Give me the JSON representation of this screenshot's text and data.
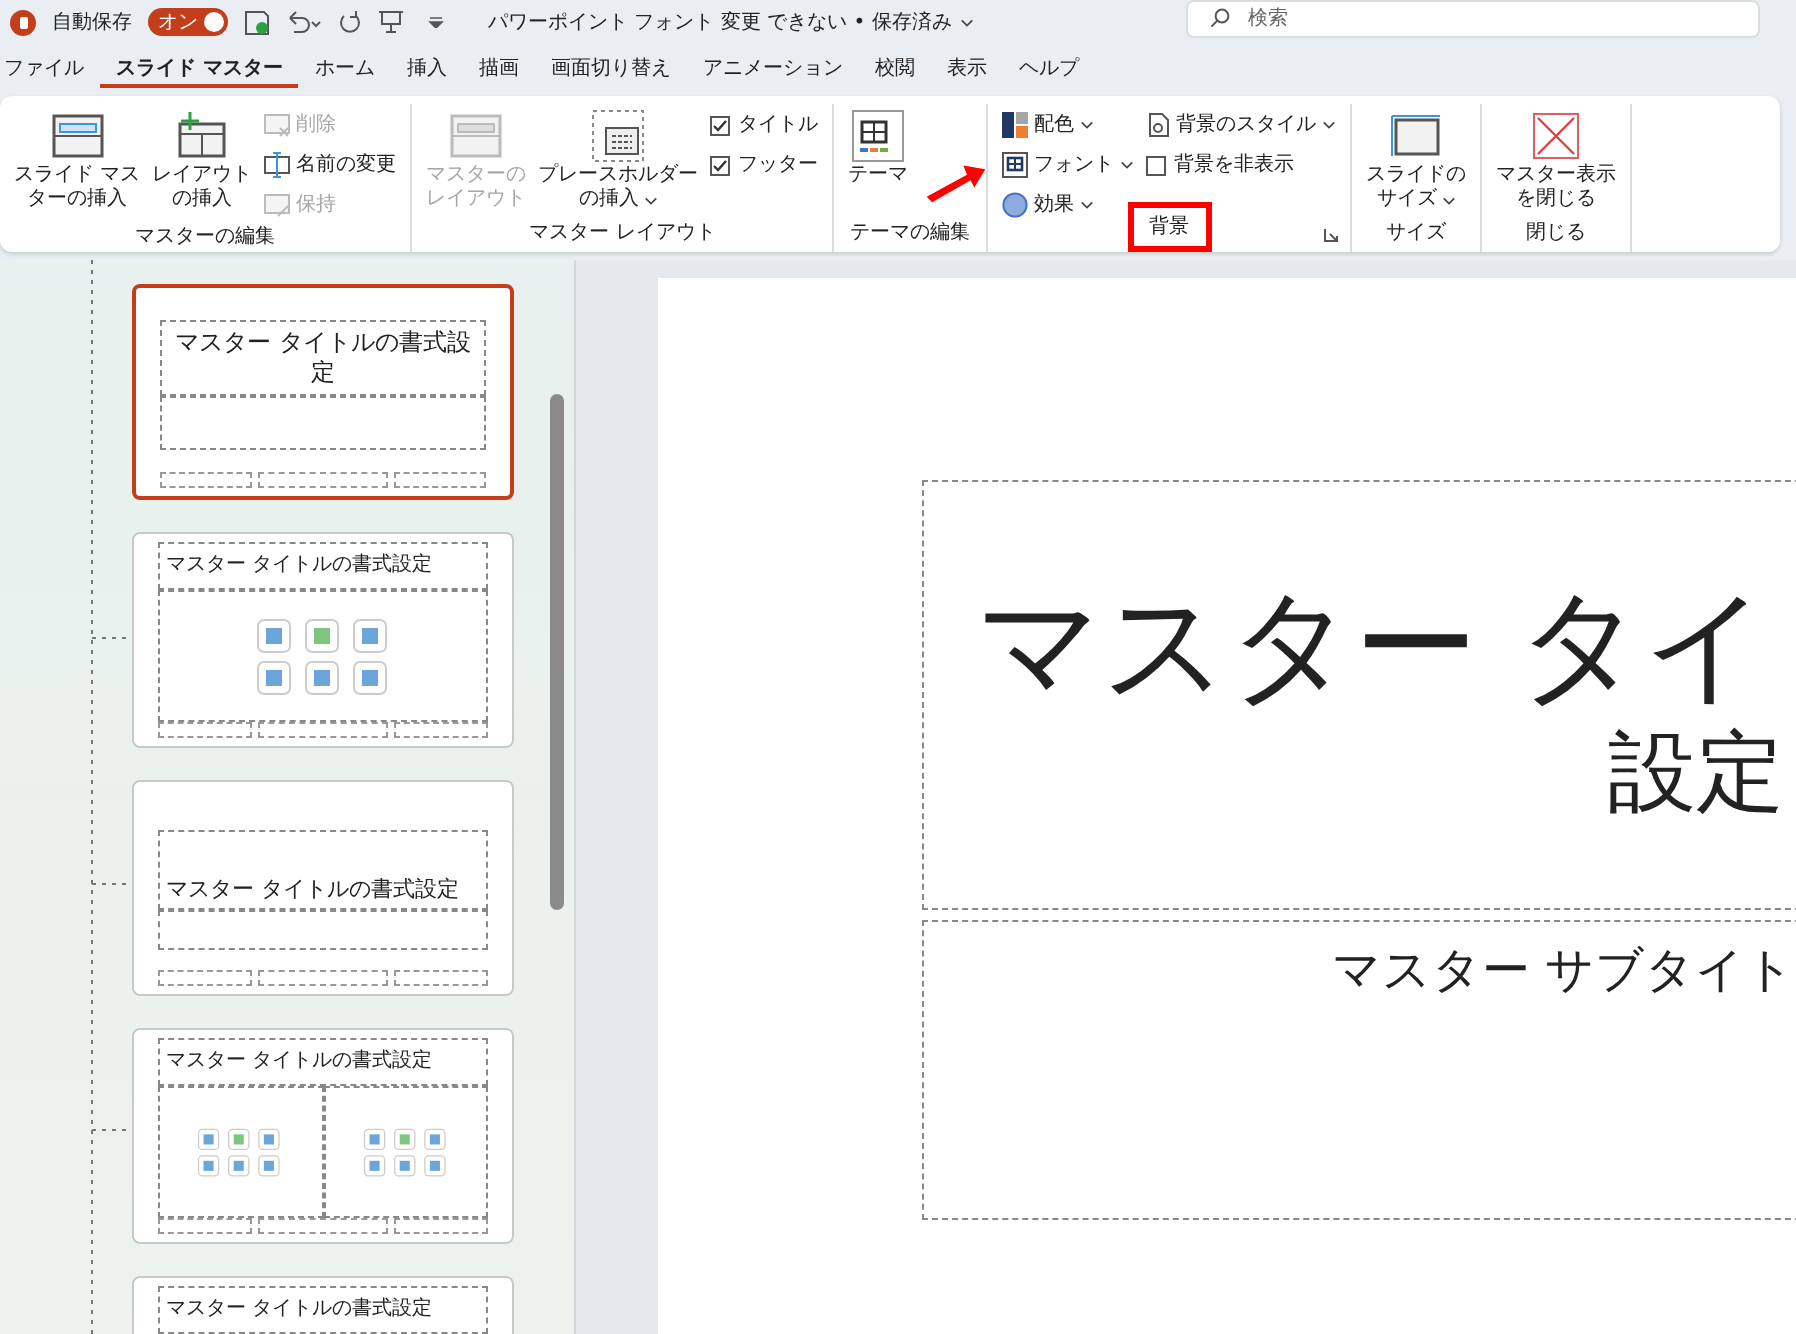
{
  "titlebar": {
    "autosave_label": "自動保存",
    "autosave_toggle": {
      "label": "オン",
      "on": true
    },
    "document_title": "パワーポイント フォント 変更 できない • 保存済み",
    "search": {
      "placeholder": "検索"
    }
  },
  "tabs": [
    {
      "label": "ファイル",
      "selected": false
    },
    {
      "label": "スライド マスター",
      "selected": true
    },
    {
      "label": "ホーム",
      "selected": false
    },
    {
      "label": "挿入",
      "selected": false
    },
    {
      "label": "描画",
      "selected": false
    },
    {
      "label": "画面切り替え",
      "selected": false
    },
    {
      "label": "アニメーション",
      "selected": false
    },
    {
      "label": "校閲",
      "selected": false
    },
    {
      "label": "表示",
      "selected": false
    },
    {
      "label": "ヘルプ",
      "selected": false
    }
  ],
  "ribbon": {
    "groups": [
      {
        "label": "マスターの編集",
        "highlighted": false,
        "launcher": false,
        "columns": [
          {
            "kind": "large",
            "lines": [
              "スライド マス",
              "ターの挿入"
            ],
            "disabled": false,
            "dropdown": false
          },
          {
            "kind": "large",
            "lines": [
              "レイアウト",
              "の挿入"
            ],
            "disabled": false,
            "dropdown": false
          },
          {
            "kind": "stack",
            "items": [
              {
                "kind": "button",
                "label": "削除",
                "disabled": true,
                "dropdown": false
              },
              {
                "kind": "button",
                "label": "名前の変更",
                "disabled": false,
                "dropdown": false
              },
              {
                "kind": "button",
                "label": "保持",
                "disabled": true,
                "dropdown": false
              }
            ]
          }
        ]
      },
      {
        "label": "マスター レイアウト",
        "highlighted": false,
        "launcher": false,
        "columns": [
          {
            "kind": "large",
            "lines": [
              "マスターの",
              "レイアウト"
            ],
            "disabled": true,
            "dropdown": false
          },
          {
            "kind": "large",
            "lines": [
              "プレースホルダー",
              "の挿入"
            ],
            "disabled": false,
            "dropdown": true
          },
          {
            "kind": "stack",
            "items": [
              {
                "kind": "check",
                "label": "タイトル",
                "checked": true
              },
              {
                "kind": "check",
                "label": "フッター",
                "checked": true
              }
            ]
          }
        ]
      },
      {
        "label": "テーマの編集",
        "highlighted": false,
        "launcher": false,
        "columns": [
          {
            "kind": "large",
            "lines": [
              "テーマ"
            ],
            "disabled": false,
            "dropdown": false
          }
        ]
      },
      {
        "label": "背景",
        "highlighted": true,
        "launcher": true,
        "columns": [
          {
            "kind": "stack",
            "items": [
              {
                "kind": "button",
                "label": "配色",
                "disabled": false,
                "dropdown": true
              },
              {
                "kind": "button",
                "label": "フォント",
                "disabled": false,
                "dropdown": true
              },
              {
                "kind": "button",
                "label": "効果",
                "disabled": false,
                "dropdown": true
              }
            ]
          },
          {
            "kind": "stack",
            "items": [
              {
                "kind": "button",
                "label": "背景のスタイル",
                "disabled": false,
                "dropdown": true
              },
              {
                "kind": "check",
                "label": "背景を非表示",
                "checked": false
              }
            ]
          }
        ]
      },
      {
        "label": "サイズ",
        "highlighted": false,
        "launcher": false,
        "columns": [
          {
            "kind": "large",
            "lines": [
              "スライドの",
              "サイズ"
            ],
            "disabled": false,
            "dropdown": true
          }
        ]
      },
      {
        "label": "閉じる",
        "highlighted": false,
        "launcher": false,
        "columns": [
          {
            "kind": "large",
            "lines": [
              "マスター表示",
              "を閉じる"
            ],
            "disabled": false,
            "dropdown": false
          }
        ]
      }
    ]
  },
  "thumbnails": [
    {
      "kind": "title",
      "title": "マスター タイトルの書式設定",
      "selected": true
    },
    {
      "kind": "content",
      "title": "マスター タイトルの書式設定",
      "selected": false
    },
    {
      "kind": "section",
      "title": "マスター タイトルの書式設定",
      "selected": false
    },
    {
      "kind": "two_content",
      "title": "マスター タイトルの書式設定",
      "selected": false
    },
    {
      "kind": "comparison",
      "title": "マスター タイトルの書式設定",
      "selected": false
    }
  ],
  "slide": {
    "title_lines": [
      "マスター タイ",
      "設定"
    ],
    "subtitle": "マスター サブタイト"
  }
}
